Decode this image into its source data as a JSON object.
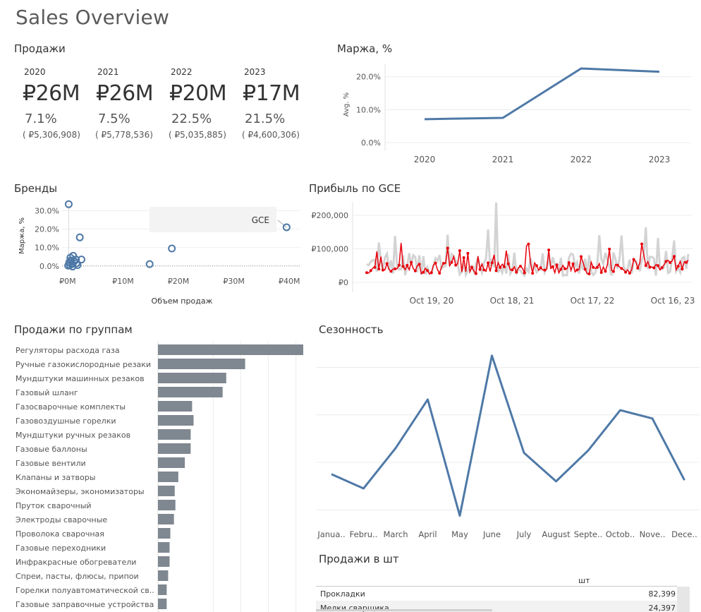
{
  "page_title": "Sales Overview",
  "sales": {
    "title": "Продажи",
    "kpis": [
      {
        "year": "2020",
        "sales": "₽26M",
        "margin": "7.1%",
        "profit": "( ₽5,306,908)"
      },
      {
        "year": "2021",
        "sales": "₽26M",
        "margin": "7.5%",
        "profit": "( ₽5,778,536)"
      },
      {
        "year": "2022",
        "sales": "₽20M",
        "margin": "22.5%",
        "profit": "( ₽5,035,885)"
      },
      {
        "year": "2023",
        "sales": "₽17M",
        "margin": "21.5%",
        "profit": "( ₽4,600,306)"
      }
    ]
  },
  "margin": {
    "title": "Маржа, %",
    "chart_data": {
      "type": "line",
      "x": [
        "2020",
        "2021",
        "2022",
        "2023"
      ],
      "values": [
        7.1,
        7.5,
        22.5,
        21.5
      ],
      "ylabel": "Avg. %",
      "y_ticks": [
        "0.0%",
        "10.0%",
        "20.0%"
      ],
      "ylim": [
        0,
        24
      ],
      "color": "#4e79a7"
    }
  },
  "brands": {
    "title": "Бренды",
    "chart_data": {
      "type": "scatter",
      "xlabel": "Объем продаж",
      "ylabel": "Маржа, %",
      "x_ticks": [
        "₽0M",
        "₽10M",
        "₽20M",
        "₽30M",
        "₽40M"
      ],
      "y_ticks": [
        "0.0%",
        "10.0%",
        "20.0%",
        "30.0%"
      ],
      "xlim": [
        -1,
        42
      ],
      "ylim": [
        -2,
        34
      ],
      "points": [
        {
          "x": 0.2,
          "y": 33.5
        },
        {
          "x": 2.2,
          "y": 15.5
        },
        {
          "x": 0.5,
          "y": 4.5
        },
        {
          "x": 1.0,
          "y": 5.5
        },
        {
          "x": 0.3,
          "y": 2.0
        },
        {
          "x": 0.8,
          "y": 1.0
        },
        {
          "x": 1.5,
          "y": 3.5
        },
        {
          "x": 0.1,
          "y": 0.2
        },
        {
          "x": 2.5,
          "y": 3.5
        },
        {
          "x": 1.8,
          "y": 0.5
        },
        {
          "x": 0.6,
          "y": 3.0
        },
        {
          "x": 1.2,
          "y": 2.5
        },
        {
          "x": 0.4,
          "y": 0.5
        },
        {
          "x": 1.6,
          "y": 1.5
        },
        {
          "x": 0.9,
          "y": -0.3
        },
        {
          "x": 18.8,
          "y": 9.5
        },
        {
          "x": 14.8,
          "y": 1.0
        },
        {
          "x": 39.5,
          "y": 21.0
        }
      ],
      "annotation": "GCE",
      "color": "#4e79a7"
    }
  },
  "profit_gce": {
    "title": "Прибыль по GCE",
    "chart_data": {
      "type": "line",
      "x_ticks": [
        "Oct 19, 20",
        "Oct 18, 21",
        "Oct 17, 22",
        "Oct 16, 23"
      ],
      "y_ticks": [
        "₽0",
        "₽100,000",
        "₽200,000"
      ],
      "ylim": [
        0,
        240000
      ],
      "series_colors": [
        "#d3d3d3",
        "#e8000b"
      ]
    }
  },
  "groups": {
    "title": "Продажи по группам",
    "chart_data": {
      "type": "bar",
      "orientation": "horizontal",
      "categories": [
        "Регуляторы расхода газа",
        "Ручные газокислородные резаки",
        "Мундштуки машинных резаков",
        "Газовый шланг",
        "Газосварочные комплекты",
        "Газовоздушные горелки",
        "Мундштуки ручных резаков",
        "Газовые баллоны",
        "Газовые вентили",
        "Клапаны и затворы",
        "Экономайзеры, экономизаторы",
        "Пруток сварочный",
        "Электроды сварочные",
        "Проволока сварочная",
        "Газовые переходники",
        "Инфракрасные обогреватели",
        "Спреи, пасты, флюсы, припои",
        "Горелки полуавтоматической св..",
        "Газовые заправочные устройства"
      ],
      "values": [
        100,
        60,
        47,
        44.5,
        23.5,
        24.5,
        22.5,
        22.5,
        18.5,
        14,
        11.5,
        12,
        11,
        8.5,
        8,
        8,
        7,
        6,
        6
      ],
      "color": "#7f8790"
    }
  },
  "seasonality": {
    "title": "Сезонность",
    "chart_data": {
      "type": "line",
      "categories": [
        "Janua..",
        "Febru..",
        "March",
        "April",
        "May",
        "June",
        "July",
        "August",
        "Septe..",
        "Octob..",
        "Nove..",
        "Dece.."
      ],
      "values": [
        30,
        18,
        52,
        93,
        -5,
        130,
        48,
        24,
        50,
        84,
        77,
        25
      ],
      "color": "#4e79a7"
    }
  },
  "units": {
    "title": "Продажи в шт",
    "column_header": "шт",
    "rows": [
      {
        "name": "Прокладки",
        "value": "82,399"
      },
      {
        "name": "Мелки сварщика",
        "value": "24,397"
      }
    ]
  }
}
